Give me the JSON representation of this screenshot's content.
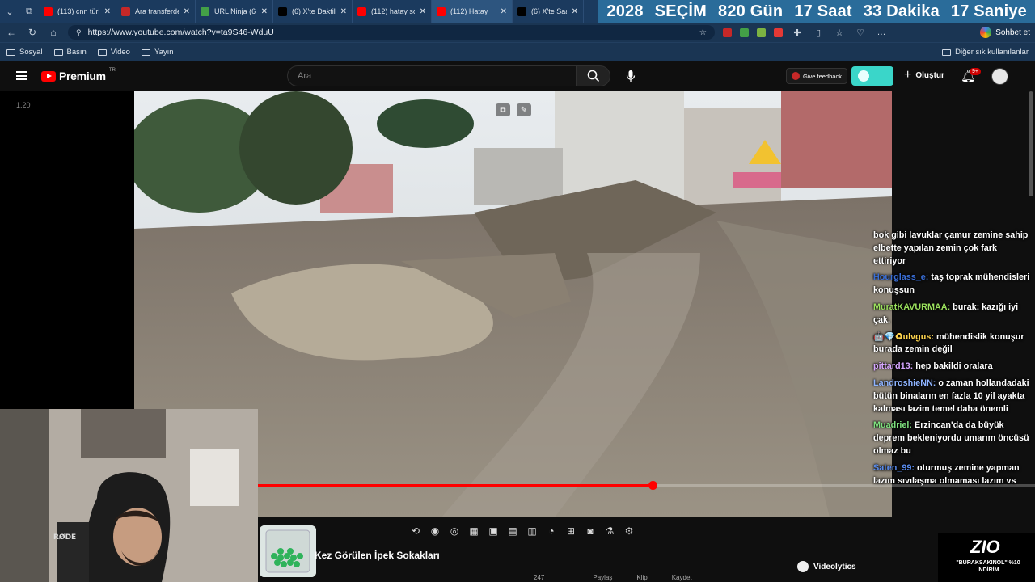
{
  "browser": {
    "tabs": [
      {
        "title": "(113) cnn türk ca",
        "favicon_color": "#ff0000"
      },
      {
        "title": "Ara transferde sc",
        "favicon_color": "#c62828"
      },
      {
        "title": "URL Ninja (62)",
        "favicon_color": "#43a047"
      },
      {
        "title": "(6) X'te Daktiloci",
        "favicon_color": "#000000"
      },
      {
        "title": "(112) hatay son d",
        "favicon_color": "#ff0000"
      },
      {
        "title": "(112) Hatay",
        "favicon_color": "#ff0000"
      },
      {
        "title": "(6) X'te Saadet P",
        "favicon_color": "#000000"
      }
    ],
    "countdown": {
      "year": "2028",
      "label": "SEÇİM",
      "days": "820 Gün",
      "hours": "17 Saat",
      "minutes": "33 Dakika",
      "seconds": "17 Saniye"
    },
    "url": "https://www.youtube.com/watch?v=ta9S46-WduU",
    "chat_button": "Sohbet et",
    "bookmarks": [
      "Sosyal",
      "Basın",
      "Video",
      "Yayın"
    ],
    "other_bookmarks": "Diğer sık kullanılanlar"
  },
  "youtube": {
    "logo": "Premium",
    "logo_region": "TR",
    "search_placeholder": "Ara",
    "feedback": "Give feedback",
    "create": "Oluştur",
    "notification_badge": "9+"
  },
  "sidebar": {
    "label": "1.20"
  },
  "video": {
    "progress_fraction": 0.508,
    "title": "Kez Görülen İpek Sokakları"
  },
  "chat": [
    {
      "user": "",
      "user_color": "#ffffff",
      "text": "bok gibi lavuklar çamur zemine sahip elbette yapılan zemin çok fark ettiriyor"
    },
    {
      "user": "Hourglass_e:",
      "user_color": "#3a6fd8",
      "text": "taş toprak mühendisleri konuşsun"
    },
    {
      "user": "MuratKAVURMAA:",
      "user_color": "#9be15d",
      "text": "burak: kazığı iyi çak."
    },
    {
      "user": "🤖💎♻ulvgus:",
      "user_color": "#ffd54f",
      "text": "mühendislik konuşur burada zemin değil"
    },
    {
      "user": "pittard13:",
      "user_color": "#d6a6ff",
      "text": "hep bakildi oralara"
    },
    {
      "user": "LandroshieNN:",
      "user_color": "#8fb4ff",
      "text": "o zaman hollandadaki bütün binaların en fazla 10 yil ayakta kalması lazim temel daha önemli"
    },
    {
      "user": "Muadriel:",
      "user_color": "#7ee07e",
      "text": "Erzincan'da da büyük deprem bekleniyordu umarım öncüsü olmaz bu"
    },
    {
      "user": "Saten_99:",
      "user_color": "#5a8df0",
      "text": "oturmuş zemine yapman lazım sıvılaşma olmaması lazım vs"
    }
  ],
  "bottom": {
    "videolytics": "Videolytics",
    "actions": [
      "247",
      "",
      "Paylaş",
      "Klip",
      "Kaydet"
    ]
  },
  "promo": {
    "brand": "ZIO",
    "code": "\"BURAKSAKINOL\" %10 İNDİRİM"
  }
}
